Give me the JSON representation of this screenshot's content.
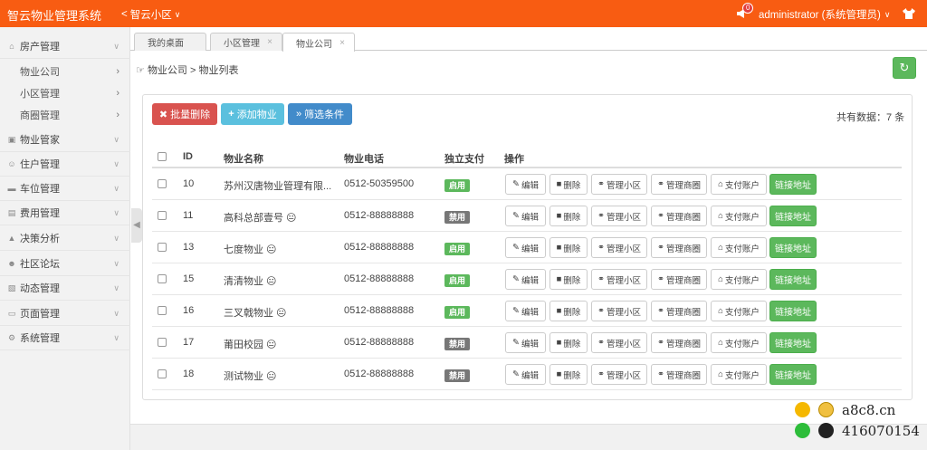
{
  "app": {
    "title": "智云物业管理系统",
    "community": "智云小区",
    "notifications": "0",
    "user": "administrator (系统管理员)"
  },
  "sidebar": {
    "items": [
      {
        "label": "房产管理",
        "icon": "home-icon"
      },
      {
        "label": "物业管家",
        "icon": "box-icon"
      },
      {
        "label": "住户管理",
        "icon": "user-icon"
      },
      {
        "label": "车位管理",
        "icon": "parking-icon"
      },
      {
        "label": "费用管理",
        "icon": "money-icon"
      },
      {
        "label": "决策分析",
        "icon": "chart-icon"
      },
      {
        "label": "社区论坛",
        "icon": "forum-icon"
      },
      {
        "label": "动态管理",
        "icon": "image-icon"
      },
      {
        "label": "页面管理",
        "icon": "page-icon"
      },
      {
        "label": "系统管理",
        "icon": "gear-icon"
      }
    ],
    "subitems": [
      {
        "label": "物业公司"
      },
      {
        "label": "小区管理"
      },
      {
        "label": "商圈管理"
      }
    ]
  },
  "tabs": [
    {
      "label": "我的桌面"
    },
    {
      "label": "小区管理"
    },
    {
      "label": "物业公司"
    }
  ],
  "breadcrumb": "物业公司 > 物业列表",
  "toolbar": {
    "batch_delete": "批量删除",
    "add": "添加物业",
    "filter": "筛选条件",
    "total": "共有数据：7 条"
  },
  "table": {
    "headers": {
      "id": "ID",
      "name": "物业名称",
      "phone": "物业电话",
      "pay": "独立支付",
      "ops": "操作"
    },
    "ops": {
      "edit": "编辑",
      "delete": "删除",
      "manage_community": "管理小区",
      "manage_business": "管理商圈",
      "pay_account": "支付账户",
      "link": "链接地址"
    },
    "rows": [
      {
        "id": "10",
        "name": "苏州汉唐物业管理有限...",
        "phone": "0512-50359500",
        "pay": "启用",
        "pay_on": true
      },
      {
        "id": "11",
        "name": "高科总部壹号 😐",
        "phone": "0512-88888888",
        "pay": "禁用",
        "pay_on": false
      },
      {
        "id": "13",
        "name": "七度物业 😐",
        "phone": "0512-88888888",
        "pay": "启用",
        "pay_on": true
      },
      {
        "id": "15",
        "name": "清清物业 😐",
        "phone": "0512-88888888",
        "pay": "启用",
        "pay_on": true
      },
      {
        "id": "16",
        "name": "三叉戟物业 😐",
        "phone": "0512-88888888",
        "pay": "启用",
        "pay_on": true
      },
      {
        "id": "17",
        "name": "莆田校园 😐",
        "phone": "0512-88888888",
        "pay": "禁用",
        "pay_on": false
      },
      {
        "id": "18",
        "name": "测试物业 😐",
        "phone": "0512-88888888",
        "pay": "禁用",
        "pay_on": false
      }
    ]
  },
  "watermark": {
    "site": "a8c8.cn",
    "qq": "416070154"
  },
  "colors": {
    "topbar": "#f85c12",
    "success": "#5cb85c",
    "danger": "#d9534f",
    "info": "#5bc0de",
    "primary": "#428bca",
    "disabled": "#777777"
  }
}
